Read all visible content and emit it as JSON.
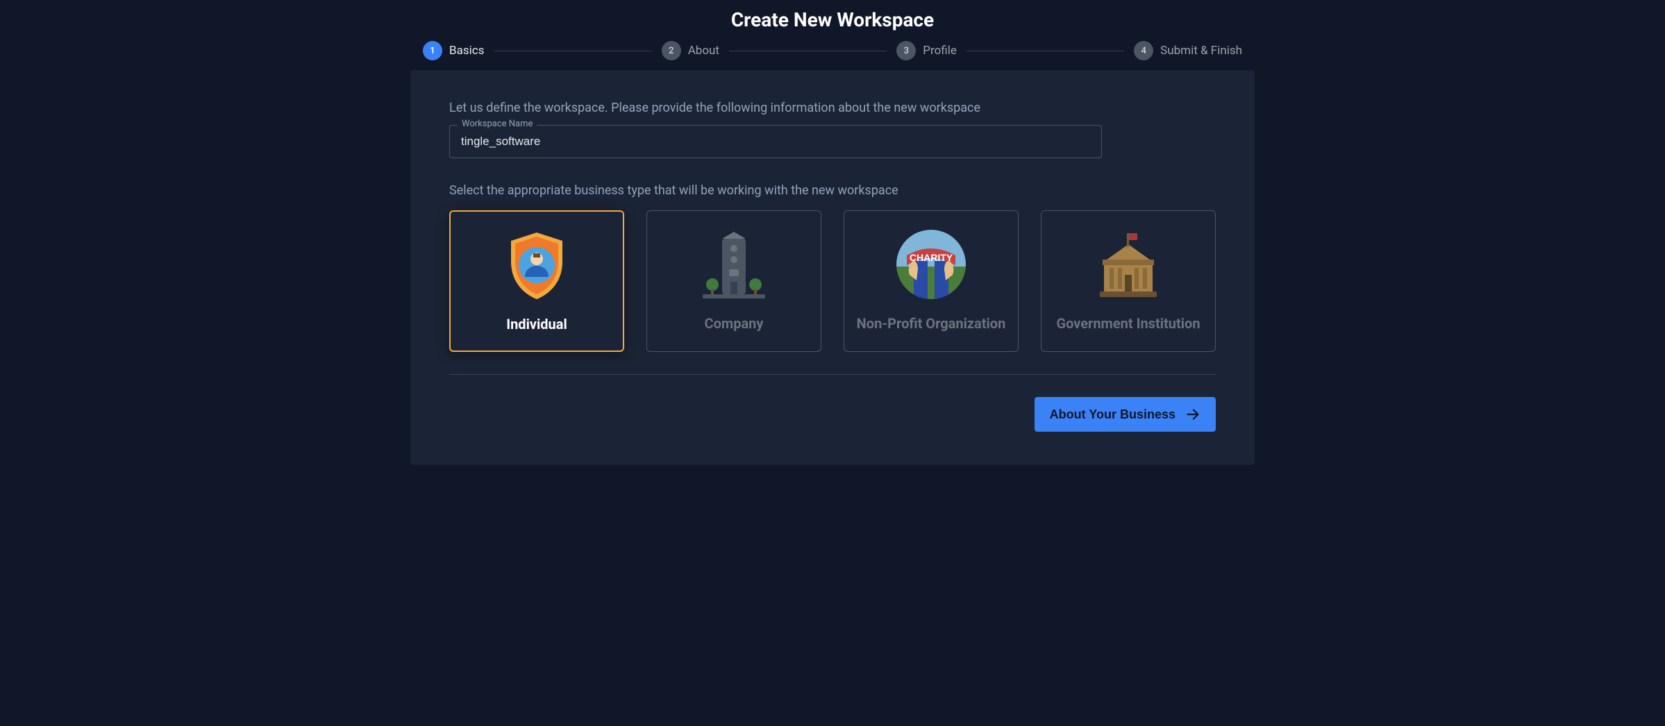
{
  "title": "Create New Workspace",
  "steps": [
    {
      "num": "1",
      "label": "Basics",
      "active": true
    },
    {
      "num": "2",
      "label": "About",
      "active": false
    },
    {
      "num": "3",
      "label": "Profile",
      "active": false
    },
    {
      "num": "4",
      "label": "Submit & Finish",
      "active": false
    }
  ],
  "intro": "Let us define the workspace. Please provide the following information about the new workspace",
  "workspace_name_label": "Workspace Name",
  "workspace_name_value": "tingle_software",
  "business_type_prompt": "Select the appropriate business type that will be working with the new workspace",
  "business_types": {
    "individual": "Individual",
    "company": "Company",
    "nonprofit": "Non-Profit Organization",
    "government": "Government Institution"
  },
  "selected_business_type": "individual",
  "next_button": "About Your Business"
}
